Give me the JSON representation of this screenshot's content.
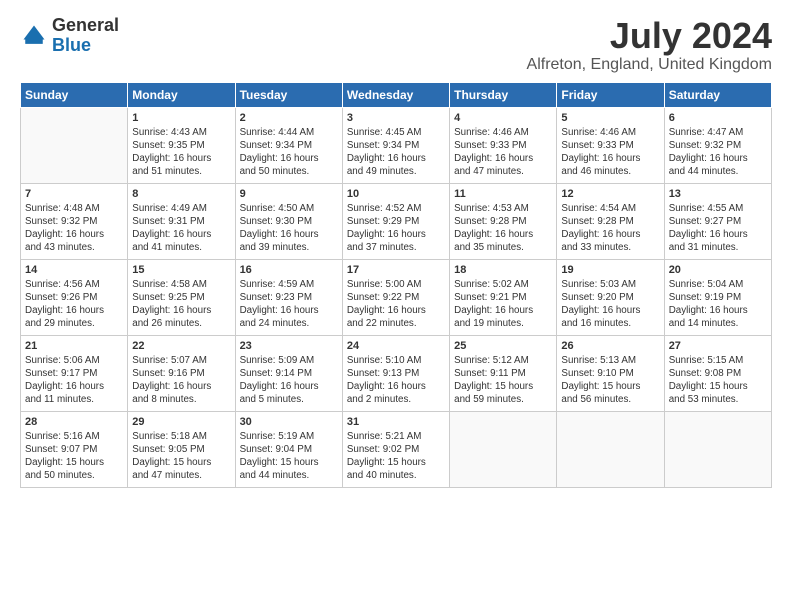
{
  "header": {
    "logo_general": "General",
    "logo_blue": "Blue",
    "month": "July 2024",
    "location": "Alfreton, England, United Kingdom"
  },
  "days_of_week": [
    "Sunday",
    "Monday",
    "Tuesday",
    "Wednesday",
    "Thursday",
    "Friday",
    "Saturday"
  ],
  "weeks": [
    [
      {
        "day": "",
        "info": ""
      },
      {
        "day": "1",
        "info": "Sunrise: 4:43 AM\nSunset: 9:35 PM\nDaylight: 16 hours\nand 51 minutes."
      },
      {
        "day": "2",
        "info": "Sunrise: 4:44 AM\nSunset: 9:34 PM\nDaylight: 16 hours\nand 50 minutes."
      },
      {
        "day": "3",
        "info": "Sunrise: 4:45 AM\nSunset: 9:34 PM\nDaylight: 16 hours\nand 49 minutes."
      },
      {
        "day": "4",
        "info": "Sunrise: 4:46 AM\nSunset: 9:33 PM\nDaylight: 16 hours\nand 47 minutes."
      },
      {
        "day": "5",
        "info": "Sunrise: 4:46 AM\nSunset: 9:33 PM\nDaylight: 16 hours\nand 46 minutes."
      },
      {
        "day": "6",
        "info": "Sunrise: 4:47 AM\nSunset: 9:32 PM\nDaylight: 16 hours\nand 44 minutes."
      }
    ],
    [
      {
        "day": "7",
        "info": "Sunrise: 4:48 AM\nSunset: 9:32 PM\nDaylight: 16 hours\nand 43 minutes."
      },
      {
        "day": "8",
        "info": "Sunrise: 4:49 AM\nSunset: 9:31 PM\nDaylight: 16 hours\nand 41 minutes."
      },
      {
        "day": "9",
        "info": "Sunrise: 4:50 AM\nSunset: 9:30 PM\nDaylight: 16 hours\nand 39 minutes."
      },
      {
        "day": "10",
        "info": "Sunrise: 4:52 AM\nSunset: 9:29 PM\nDaylight: 16 hours\nand 37 minutes."
      },
      {
        "day": "11",
        "info": "Sunrise: 4:53 AM\nSunset: 9:28 PM\nDaylight: 16 hours\nand 35 minutes."
      },
      {
        "day": "12",
        "info": "Sunrise: 4:54 AM\nSunset: 9:28 PM\nDaylight: 16 hours\nand 33 minutes."
      },
      {
        "day": "13",
        "info": "Sunrise: 4:55 AM\nSunset: 9:27 PM\nDaylight: 16 hours\nand 31 minutes."
      }
    ],
    [
      {
        "day": "14",
        "info": "Sunrise: 4:56 AM\nSunset: 9:26 PM\nDaylight: 16 hours\nand 29 minutes."
      },
      {
        "day": "15",
        "info": "Sunrise: 4:58 AM\nSunset: 9:25 PM\nDaylight: 16 hours\nand 26 minutes."
      },
      {
        "day": "16",
        "info": "Sunrise: 4:59 AM\nSunset: 9:23 PM\nDaylight: 16 hours\nand 24 minutes."
      },
      {
        "day": "17",
        "info": "Sunrise: 5:00 AM\nSunset: 9:22 PM\nDaylight: 16 hours\nand 22 minutes."
      },
      {
        "day": "18",
        "info": "Sunrise: 5:02 AM\nSunset: 9:21 PM\nDaylight: 16 hours\nand 19 minutes."
      },
      {
        "day": "19",
        "info": "Sunrise: 5:03 AM\nSunset: 9:20 PM\nDaylight: 16 hours\nand 16 minutes."
      },
      {
        "day": "20",
        "info": "Sunrise: 5:04 AM\nSunset: 9:19 PM\nDaylight: 16 hours\nand 14 minutes."
      }
    ],
    [
      {
        "day": "21",
        "info": "Sunrise: 5:06 AM\nSunset: 9:17 PM\nDaylight: 16 hours\nand 11 minutes."
      },
      {
        "day": "22",
        "info": "Sunrise: 5:07 AM\nSunset: 9:16 PM\nDaylight: 16 hours\nand 8 minutes."
      },
      {
        "day": "23",
        "info": "Sunrise: 5:09 AM\nSunset: 9:14 PM\nDaylight: 16 hours\nand 5 minutes."
      },
      {
        "day": "24",
        "info": "Sunrise: 5:10 AM\nSunset: 9:13 PM\nDaylight: 16 hours\nand 2 minutes."
      },
      {
        "day": "25",
        "info": "Sunrise: 5:12 AM\nSunset: 9:11 PM\nDaylight: 15 hours\nand 59 minutes."
      },
      {
        "day": "26",
        "info": "Sunrise: 5:13 AM\nSunset: 9:10 PM\nDaylight: 15 hours\nand 56 minutes."
      },
      {
        "day": "27",
        "info": "Sunrise: 5:15 AM\nSunset: 9:08 PM\nDaylight: 15 hours\nand 53 minutes."
      }
    ],
    [
      {
        "day": "28",
        "info": "Sunrise: 5:16 AM\nSunset: 9:07 PM\nDaylight: 15 hours\nand 50 minutes."
      },
      {
        "day": "29",
        "info": "Sunrise: 5:18 AM\nSunset: 9:05 PM\nDaylight: 15 hours\nand 47 minutes."
      },
      {
        "day": "30",
        "info": "Sunrise: 5:19 AM\nSunset: 9:04 PM\nDaylight: 15 hours\nand 44 minutes."
      },
      {
        "day": "31",
        "info": "Sunrise: 5:21 AM\nSunset: 9:02 PM\nDaylight: 15 hours\nand 40 minutes."
      },
      {
        "day": "",
        "info": ""
      },
      {
        "day": "",
        "info": ""
      },
      {
        "day": "",
        "info": ""
      }
    ]
  ]
}
